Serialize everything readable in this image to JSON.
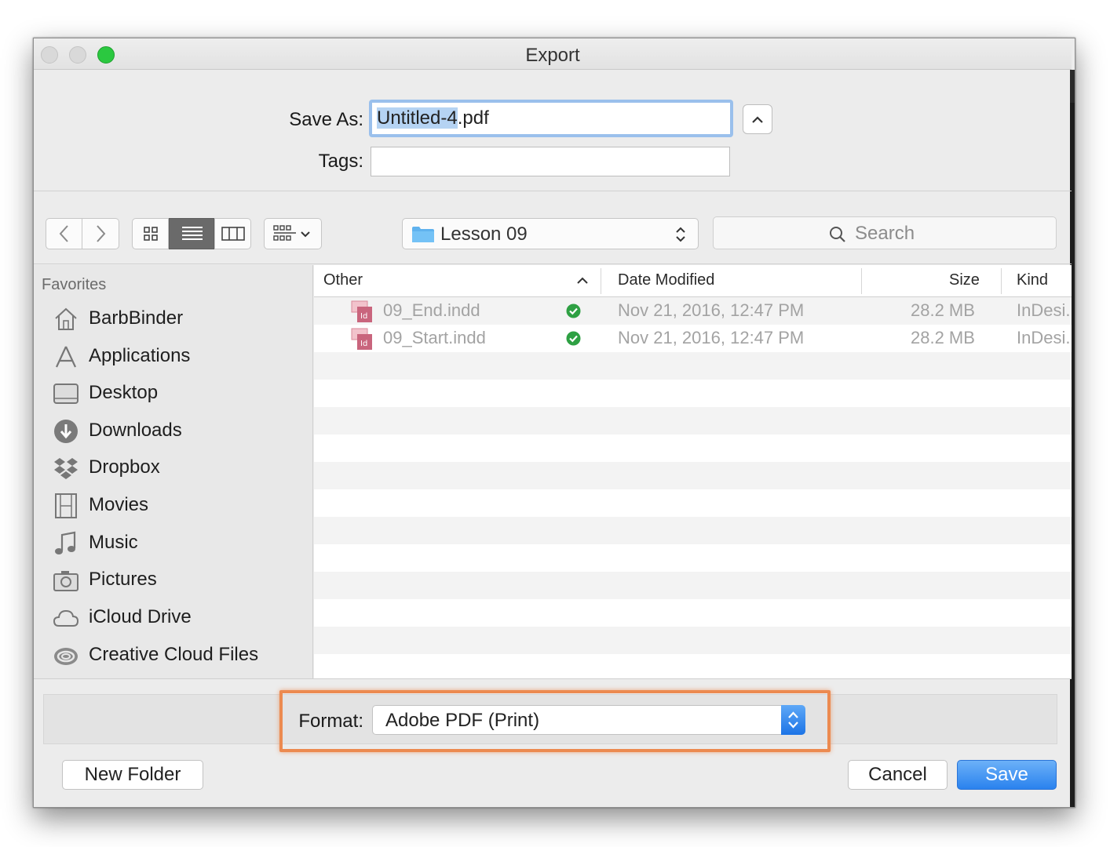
{
  "window": {
    "title": "Export"
  },
  "save": {
    "save_as_label": "Save As:",
    "filename_highlighted": "Untitled-4",
    "filename_ext": ".pdf",
    "tags_label": "Tags:",
    "tags_value": ""
  },
  "toolbar": {
    "location": "Lesson 09",
    "search_placeholder": "Search"
  },
  "sidebar": {
    "header": "Favorites",
    "items": [
      {
        "label": "BarbBinder",
        "icon": "home-icon"
      },
      {
        "label": "Applications",
        "icon": "applications-icon"
      },
      {
        "label": "Desktop",
        "icon": "desktop-icon"
      },
      {
        "label": "Downloads",
        "icon": "downloads-icon"
      },
      {
        "label": "Dropbox",
        "icon": "dropbox-icon"
      },
      {
        "label": "Movies",
        "icon": "movies-icon"
      },
      {
        "label": "Music",
        "icon": "music-icon"
      },
      {
        "label": "Pictures",
        "icon": "pictures-icon"
      },
      {
        "label": "iCloud Drive",
        "icon": "icloud-icon"
      },
      {
        "label": "Creative Cloud Files",
        "icon": "creative-cloud-icon"
      }
    ]
  },
  "list": {
    "columns": {
      "name": "Other",
      "date": "Date Modified",
      "size": "Size",
      "kind": "Kind"
    },
    "rows": [
      {
        "name": "09_End.indd",
        "date": "Nov 21, 2016, 12:47 PM",
        "size": "28.2 MB",
        "kind": "InDesi..."
      },
      {
        "name": "09_Start.indd",
        "date": "Nov 21, 2016, 12:47 PM",
        "size": "28.2 MB",
        "kind": "InDesi..."
      }
    ]
  },
  "format": {
    "label": "Format:",
    "value": "Adobe PDF (Print)"
  },
  "buttons": {
    "new_folder": "New Folder",
    "cancel": "Cancel",
    "save": "Save"
  },
  "colors": {
    "accent": "#2a82ee",
    "highlight_box": "#ec8a50",
    "sync_ok": "#2ea043",
    "zoom_button": "#2bc840"
  }
}
